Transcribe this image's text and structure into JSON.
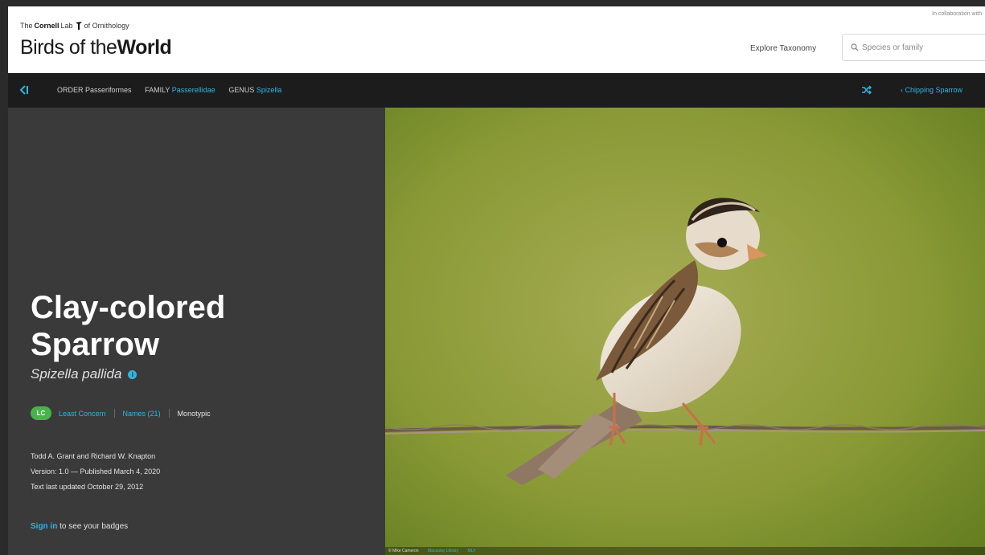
{
  "header": {
    "logo_small_prefix": "The",
    "logo_small_bold": "Cornell",
    "logo_small_mid": "Lab",
    "logo_small_suffix": "of Ornithology",
    "logo_title_light": "Birds of the",
    "logo_title_bold": "World",
    "collab_text": "In collaboration with",
    "explore_label": "Explore Taxonomy",
    "search_placeholder": "Species or family"
  },
  "navbar": {
    "breadcrumbs": [
      {
        "label": "ORDER",
        "value": "Passeriformes"
      },
      {
        "label": "FAMILY",
        "value": "Passerellidae"
      },
      {
        "label": "GENUS",
        "value": "Spizella"
      }
    ],
    "prev_species": "Chipping Sparrow"
  },
  "species": {
    "common_name_line1": "Clay-colored",
    "common_name_line2": "Sparrow",
    "scientific_name": "Spizella pallida",
    "status_code": "LC",
    "status_label": "Least Concern",
    "names_label": "Names (21)",
    "taxon_label": "Monotypic",
    "authors": "Todd A. Grant and Richard W. Knapton",
    "version": "Version: 1.0 — Published March 4, 2020",
    "updated": "Text last updated October 29, 2012"
  },
  "signin": {
    "link": "Sign in",
    "rest": " to see your badges"
  },
  "photo": {
    "credit": "© Mike Cameron",
    "credit_link": "Macaulay Library",
    "credit_num": "ML#"
  },
  "colors": {
    "accent": "#2fb6e0",
    "status_lc": "#46b548",
    "panel_bg": "#3a3a3a",
    "nav_bg": "#1c1c1c"
  }
}
